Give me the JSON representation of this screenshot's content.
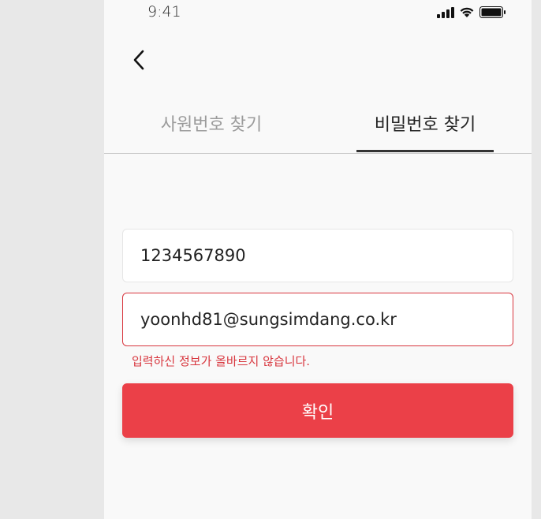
{
  "status_bar": {
    "time": "9:41",
    "icons": [
      "signal-icon",
      "wifi-icon",
      "battery-icon"
    ]
  },
  "nav": {
    "back_icon": "chevron-left-icon"
  },
  "tabs": [
    {
      "label": "사원번호 찾기",
      "active": false
    },
    {
      "label": "비밀번호 찾기",
      "active": true
    }
  ],
  "form": {
    "employee_number": {
      "value": "1234567890"
    },
    "email": {
      "value": "yoonhd81@sungsimdang.co.kr",
      "error": true
    },
    "error_message": "입력하신 정보가 올바르지 않습니다.",
    "confirm_label": "확인"
  },
  "colors": {
    "accent": "#eb4048",
    "error": "#d8363e",
    "active_tab": "#222222",
    "inactive_tab": "#9b9b9b",
    "background": "#f9f9f9"
  }
}
